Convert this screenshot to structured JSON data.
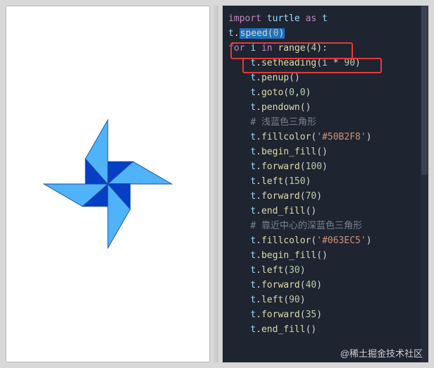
{
  "output": {
    "pinwheel": {
      "color_light": "#50B2F8",
      "color_dark": "#063EC5",
      "color_outline": "#1a4f9e"
    }
  },
  "code": {
    "lines": [
      {
        "raw": "import turtle as t",
        "type": "import"
      },
      {
        "raw": "t.speed(0)",
        "type": "call",
        "selected_suffix": "speed(0)"
      },
      {
        "raw": "",
        "type": "blank"
      },
      {
        "raw": "for i in range(4):",
        "type": "for"
      },
      {
        "raw": "    t.setheading(i * 90)",
        "type": "call"
      },
      {
        "raw": "    t.penup()",
        "type": "call"
      },
      {
        "raw": "    t.goto(0,0)",
        "type": "call"
      },
      {
        "raw": "    t.pendown()",
        "type": "call"
      },
      {
        "raw": "    # 浅蓝色三角形",
        "type": "comment"
      },
      {
        "raw": "    t.fillcolor('#50B2F8')",
        "type": "call"
      },
      {
        "raw": "    t.begin_fill()",
        "type": "call"
      },
      {
        "raw": "    t.forward(100)",
        "type": "call"
      },
      {
        "raw": "    t.left(150)",
        "type": "call"
      },
      {
        "raw": "    t.forward(70)",
        "type": "call"
      },
      {
        "raw": "    t.end_fill()",
        "type": "call"
      },
      {
        "raw": "    # 靠近中心的深蓝色三角形",
        "type": "comment"
      },
      {
        "raw": "    t.fillcolor('#063EC5')",
        "type": "call"
      },
      {
        "raw": "    t.begin_fill()",
        "type": "call"
      },
      {
        "raw": "    t.left(30)",
        "type": "call"
      },
      {
        "raw": "    t.forward(40)",
        "type": "call"
      },
      {
        "raw": "    t.left(90)",
        "type": "call"
      },
      {
        "raw": "    t.forward(35)",
        "type": "call"
      },
      {
        "raw": "    t.end_fill()",
        "type": "call"
      }
    ]
  },
  "watermark": "@稀土掘金技术社区"
}
